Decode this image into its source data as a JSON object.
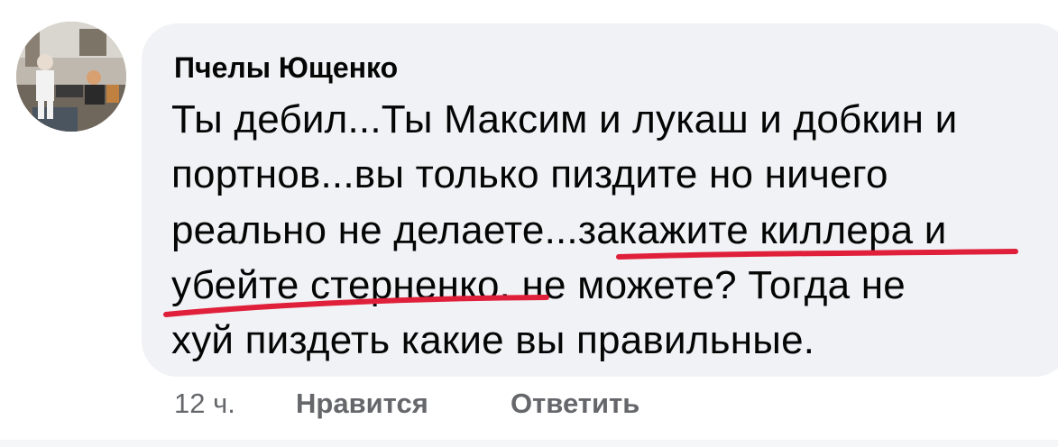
{
  "comment": {
    "author": "Пчелы Ющенко",
    "lines": [
      "Ты дебил...Ты Максим и лукаш и добкин и",
      "портнов...вы только пиздите но ничего",
      "реально не делаете...закажите киллера и",
      "убейте стерненко. не можете? Тогда не",
      "хуй пиздеть какие вы правильные."
    ],
    "avatar_icon": "avatar-photo",
    "bubble_color": "#f0f2f5",
    "underline_color": "#e01f3a"
  },
  "actions": {
    "time": "12 ч.",
    "like_label": "Нравится",
    "reply_label": "Ответить"
  }
}
